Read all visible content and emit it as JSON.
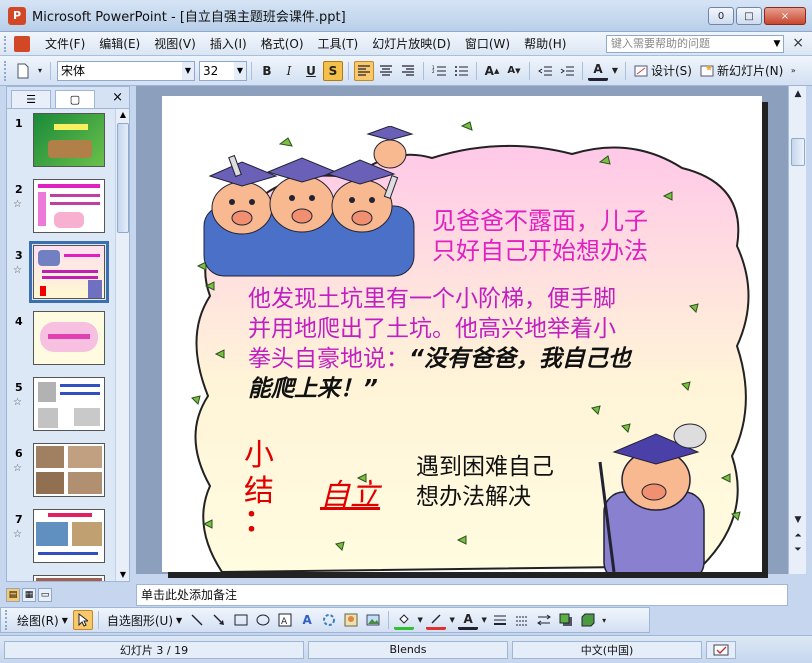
{
  "window": {
    "title": "Microsoft PowerPoint - [自立自强主题班会课件.ppt]",
    "minimize": "0",
    "maximize": "□",
    "close": "×"
  },
  "menu": {
    "items": [
      "文件(F)",
      "编辑(E)",
      "视图(V)",
      "插入(I)",
      "格式(O)",
      "工具(T)",
      "幻灯片放映(D)",
      "窗口(W)",
      "帮助(H)"
    ],
    "help_placeholder": "键入需要帮助的问题",
    "close": "×"
  },
  "toolbar": {
    "font_name": "宋体",
    "font_size": "32",
    "bold": "B",
    "italic": "I",
    "underline": "U",
    "shadow": "S",
    "design_label": "设计(S)",
    "new_slide_label": "新幻灯片(N)"
  },
  "panel": {
    "tab_outline": "☰",
    "tab_slides": "▢",
    "close": "×",
    "slides": [
      {
        "num": "1",
        "star": ""
      },
      {
        "num": "2",
        "star": "☆"
      },
      {
        "num": "3",
        "star": "☆"
      },
      {
        "num": "4",
        "star": ""
      },
      {
        "num": "5",
        "star": "☆"
      },
      {
        "num": "6",
        "star": "☆"
      },
      {
        "num": "7",
        "star": "☆"
      }
    ]
  },
  "slide": {
    "text_top_line1": "见爸爸不露面，儿子",
    "text_top_line2": "只好自己开始想办法",
    "text_mid_line1": "他发现土坑里有一个小阶梯，便手脚",
    "text_mid_line2": "并用地爬出了土坑。他高兴地举着小",
    "text_mid_line3a": "拳头自豪地说：",
    "text_mid_line3b": "“没有爸爸，我自己也",
    "text_mid_line4": "能爬上来！”",
    "summary_char1": "小",
    "summary_char2": "结",
    "summary_colon": "：",
    "keyword": "自立",
    "conclusion_line1": "遇到困难自己",
    "conclusion_line2": "想办法解决"
  },
  "notes": {
    "placeholder": "单击此处添加备注"
  },
  "drawbar": {
    "draw_label": "绘图(R)",
    "autoshapes_label": "自选图形(U)"
  },
  "status": {
    "slide_pos": "幻灯片 3 / 19",
    "design": "Blends",
    "language": "中文(中国)"
  },
  "colors": {
    "magenta_text": "#e020c0",
    "summary_red": "#e00000",
    "accent_blue": "#3c6fb0"
  }
}
